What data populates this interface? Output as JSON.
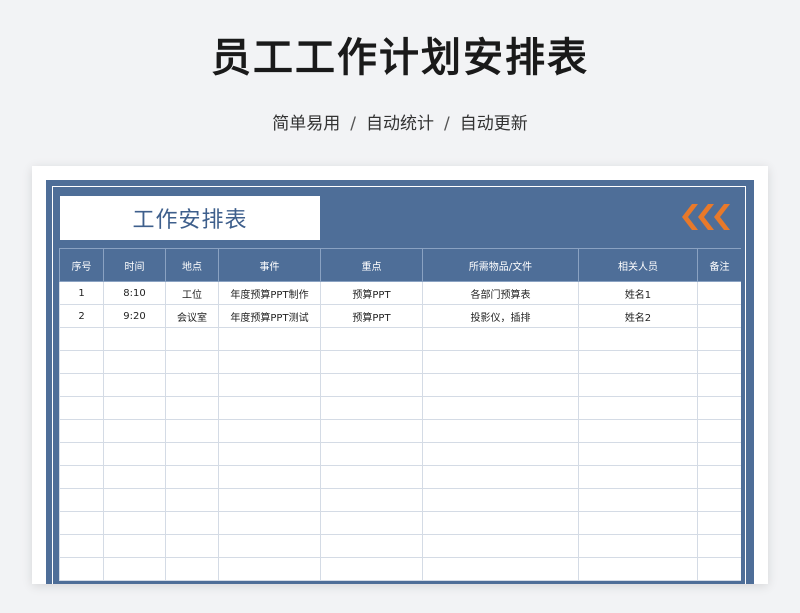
{
  "title": "员工工作计划安排表",
  "subtitle": {
    "part1": "简单易用",
    "sep": "/",
    "part2": "自动统计",
    "part3": "自动更新"
  },
  "sheet": {
    "banner_title": "工作安排表",
    "accent_color": "#e8792a",
    "header_color": "#4e6e98",
    "columns": [
      "序号",
      "时间",
      "地点",
      "事件",
      "重点",
      "所需物品/文件",
      "相关人员",
      "备注"
    ],
    "rows": [
      [
        "1",
        "8:10",
        "工位",
        "年度预算PPT制作",
        "预算PPT",
        "各部门预算表",
        "姓名1",
        ""
      ],
      [
        "2",
        "9:20",
        "会议室",
        "年度预算PPT测试",
        "预算PPT",
        "投影仪，插排",
        "姓名2",
        ""
      ],
      [
        "",
        "",
        "",
        "",
        "",
        "",
        "",
        ""
      ],
      [
        "",
        "",
        "",
        "",
        "",
        "",
        "",
        ""
      ],
      [
        "",
        "",
        "",
        "",
        "",
        "",
        "",
        ""
      ],
      [
        "",
        "",
        "",
        "",
        "",
        "",
        "",
        ""
      ],
      [
        "",
        "",
        "",
        "",
        "",
        "",
        "",
        ""
      ],
      [
        "",
        "",
        "",
        "",
        "",
        "",
        "",
        ""
      ],
      [
        "",
        "",
        "",
        "",
        "",
        "",
        "",
        ""
      ],
      [
        "",
        "",
        "",
        "",
        "",
        "",
        "",
        ""
      ],
      [
        "",
        "",
        "",
        "",
        "",
        "",
        "",
        ""
      ],
      [
        "",
        "",
        "",
        "",
        "",
        "",
        "",
        ""
      ],
      [
        "",
        "",
        "",
        "",
        "",
        "",
        "",
        ""
      ]
    ]
  }
}
